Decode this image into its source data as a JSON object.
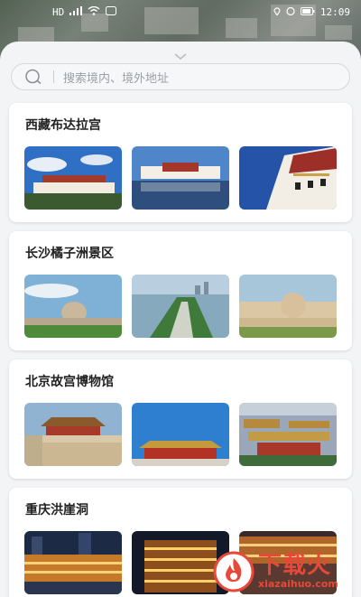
{
  "status_bar": {
    "left_text": "HD",
    "time": "12:09",
    "icons": [
      "signal-icon",
      "wifi-icon",
      "notification-icon",
      "location-icon",
      "alarm-icon",
      "battery-icon"
    ]
  },
  "search": {
    "placeholder": "搜索境内、境外地址",
    "icon": "search-icon"
  },
  "sections": [
    {
      "title": "西藏布达拉宫",
      "images": [
        "palace-sky-photo",
        "palace-reflection-photo",
        "palace-closeup-photo"
      ]
    },
    {
      "title": "长沙橘子洲景区",
      "images": [
        "statue-sky-photo",
        "island-aerial-photo",
        "statue-sunset-photo"
      ]
    },
    {
      "title": "北京故宫博物馆",
      "images": [
        "forbidden-city-courtyard-photo",
        "forbidden-city-gate-photo",
        "forbidden-city-aerial-photo"
      ]
    },
    {
      "title": "重庆洪崖洞",
      "images": [
        "hongyadong-night-photo",
        "hongyadong-lights-photo",
        "hongyadong-river-photo"
      ]
    }
  ],
  "watermark": {
    "main": "下载火",
    "sub": "xiazaihuo.com"
  },
  "colors": {
    "sheet_bg": "#f3f4f6",
    "card_bg": "#ffffff",
    "title_text": "#222222",
    "placeholder_text": "#9ba0a6",
    "watermark": "#e8483a"
  }
}
